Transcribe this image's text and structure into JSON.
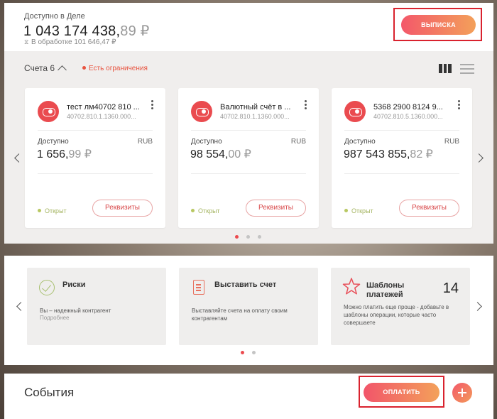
{
  "balance": {
    "label": "Доступно в Деле",
    "amount_main": "1 043 174 438,",
    "amount_frac": "89 ₽",
    "processing_icon": "hourglass-icon",
    "processing_text": "В обработке 101 646,47 ₽"
  },
  "statement_button": "ВЫПИСКА",
  "accounts": {
    "header": "Счета 6",
    "restriction": "Есть ограничения",
    "slider": {
      "pages": 3,
      "active": 0
    },
    "cards": [
      {
        "name": "тест лм40702 810 ...",
        "number": "40702.810.1.1360.000...",
        "available_label": "Доступно",
        "currency": "RUB",
        "balance_main": "1 656,",
        "balance_frac": "99 ₽",
        "status": "Открыт",
        "details_button": "Реквизиты"
      },
      {
        "name": "Валютный счёт в ...",
        "number": "40702.810.1.1360.000...",
        "available_label": "Доступно",
        "currency": "RUB",
        "balance_main": "98 554,",
        "balance_frac": "00 ₽",
        "status": "Открыт",
        "details_button": "Реквизиты"
      },
      {
        "name": "5368 2900 8124 9...",
        "number": "40702.810.5.1360.000...",
        "available_label": "Доступно",
        "currency": "RUB",
        "balance_main": "987 543 855,",
        "balance_frac": "82 ₽",
        "status": "Открыт",
        "details_button": "Реквизиты"
      }
    ]
  },
  "widgets": {
    "slider": {
      "pages": 2,
      "active": 0
    },
    "tiles": [
      {
        "title": "Риски",
        "desc": "Вы – надежный контрагент",
        "more": "Подробнее",
        "icon": "check-circle-icon"
      },
      {
        "title": "Выставить счет",
        "desc": "Выставляйте счета на оплату своим контрагентам",
        "icon": "invoice-icon"
      },
      {
        "title": "Шаблоны платежей",
        "count": "14",
        "desc": "Можно платить еще проще - добавьте в шаблоны операции, которые часто совершаете",
        "icon": "star-icon"
      }
    ]
  },
  "events": {
    "title": "События",
    "pay_button": "ОПЛАТИТЬ",
    "add_icon": "plus-icon"
  },
  "colors": {
    "accent": "#ea4b4f",
    "gradient_start": "#f3586a",
    "gradient_end": "#f3a05a",
    "open_status": "#b8c862",
    "highlight_frame": "#d9222e"
  }
}
